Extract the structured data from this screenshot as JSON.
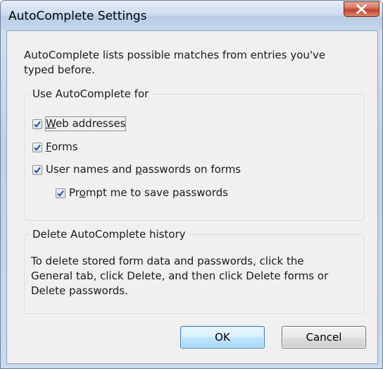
{
  "window": {
    "title": "AutoComplete Settings"
  },
  "intro": {
    "line1": "AutoComplete lists possible matches from entries you've",
    "line2": "typed before."
  },
  "use_group": {
    "legend": "Use AutoComplete for",
    "options": [
      {
        "label_ul": "W",
        "label_rest": "eb addresses",
        "checked": true
      },
      {
        "label_ul": "F",
        "label_rest": "orms",
        "checked": true
      },
      {
        "label_pre": "User names and ",
        "label_ul": "p",
        "label_rest": "asswords on forms",
        "checked": true
      },
      {
        "label_pre": "Pr",
        "label_ul": "o",
        "label_rest": "mpt me to save passwords",
        "checked": true
      }
    ]
  },
  "delete_group": {
    "legend": "Delete AutoComplete history",
    "line1": "To delete stored form data and passwords, click the",
    "line2": "General tab, click Delete, and then click Delete forms or",
    "line3": "Delete passwords."
  },
  "buttons": {
    "ok": "OK",
    "cancel": "Cancel"
  },
  "colors": {
    "checkmark": "#2c4c8c",
    "close_button": "#c2432d"
  }
}
